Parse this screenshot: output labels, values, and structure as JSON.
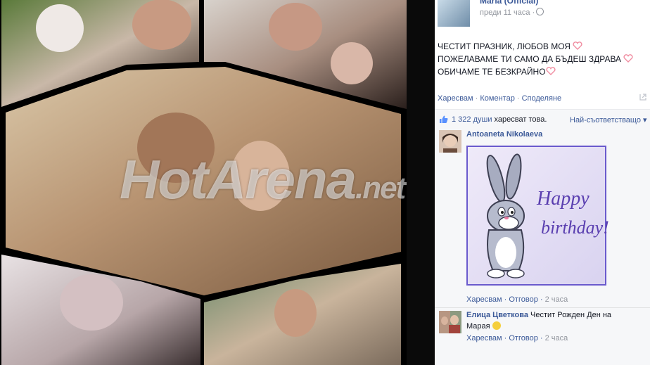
{
  "post": {
    "page_name": "Maria (Official)",
    "time": "преди 11 часа ·",
    "lines": [
      "ЧЕСТИТ ПРАЗНИК, ЛЮБОВ МОЯ",
      "ПОЖЕЛАВАМЕ ТИ САМО ДА БЪДЕШ ЗДРАВА",
      "ОБИЧАМЕ ТЕ БЕЗКРАЙНО"
    ],
    "actions": {
      "like": "Харесвам",
      "comment": "Коментар",
      "share": "Споделяне",
      "sep": " · "
    }
  },
  "likes": {
    "count": "1 322 души",
    "suffix": " харесват това.",
    "sort": "Най-съответстващо ▾"
  },
  "comments": [
    {
      "name": "Antoaneta Nikolaeva",
      "text": "",
      "image_text_1": "Happy",
      "image_text_2": "birthday!",
      "like": "Харесвам",
      "reply": "Отговор",
      "time": "2 часа"
    },
    {
      "name": "Елица Цветкова",
      "text": " Честит Рожден Ден на",
      "text2": "Марая",
      "like": "Харесвам",
      "reply": "Отговор",
      "time": "2 часа"
    }
  ],
  "watermark": "HotArena",
  "watermark_suffix": ".net",
  "colors": {
    "link": "#3b5998",
    "muted": "#90949c",
    "heart": "#f08ca0"
  },
  "icons": [
    "globe-icon",
    "heart-emoji-icon",
    "like-thumb-icon",
    "share-icon",
    "smile-emoji-icon"
  ]
}
